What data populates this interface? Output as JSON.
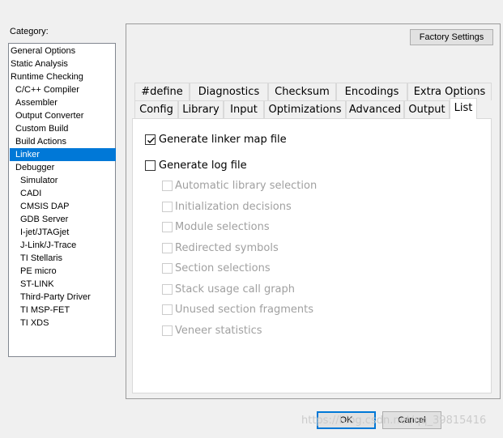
{
  "category": {
    "label": "Category:",
    "items": [
      {
        "label": "General Options"
      },
      {
        "label": "Static Analysis"
      },
      {
        "label": "Runtime Checking"
      },
      {
        "label": "C/C++ Compiler"
      },
      {
        "label": "Assembler"
      },
      {
        "label": "Output Converter"
      },
      {
        "label": "Custom Build"
      },
      {
        "label": "Build Actions"
      },
      {
        "label": "Linker",
        "selected": true
      },
      {
        "label": "Debugger"
      },
      {
        "label": "Simulator"
      },
      {
        "label": "CADI"
      },
      {
        "label": "CMSIS DAP"
      },
      {
        "label": "GDB Server"
      },
      {
        "label": "I-jet/JTAGjet"
      },
      {
        "label": "J-Link/J-Trace"
      },
      {
        "label": "TI Stellaris"
      },
      {
        "label": "PE micro"
      },
      {
        "label": "ST-LINK"
      },
      {
        "label": "Third-Party Driver"
      },
      {
        "label": "TI MSP-FET"
      },
      {
        "label": "TI XDS"
      }
    ]
  },
  "factory_settings_label": "Factory Settings",
  "tabs": {
    "row1": [
      "#define",
      "Diagnostics",
      "Checksum",
      "Encodings",
      "Extra Options"
    ],
    "row2": [
      "Config",
      "Library",
      "Input",
      "Optimizations",
      "Advanced",
      "Output",
      "List"
    ],
    "active": "List"
  },
  "options": {
    "generate_map": {
      "label": "Generate linker map file",
      "checked": true
    },
    "generate_log": {
      "label": "Generate log file",
      "checked": false
    },
    "log_items": [
      {
        "label": "Automatic library selection"
      },
      {
        "label": "Initialization decisions"
      },
      {
        "label": "Module selections"
      },
      {
        "label": "Redirected symbols"
      },
      {
        "label": "Section selections"
      },
      {
        "label": "Stack usage call graph"
      },
      {
        "label": "Unused section fragments"
      },
      {
        "label": "Veneer statistics"
      }
    ]
  },
  "buttons": {
    "ok": "OK",
    "cancel": "Cancel"
  },
  "watermark": "https://blog.csdn.net/qq_39815416"
}
